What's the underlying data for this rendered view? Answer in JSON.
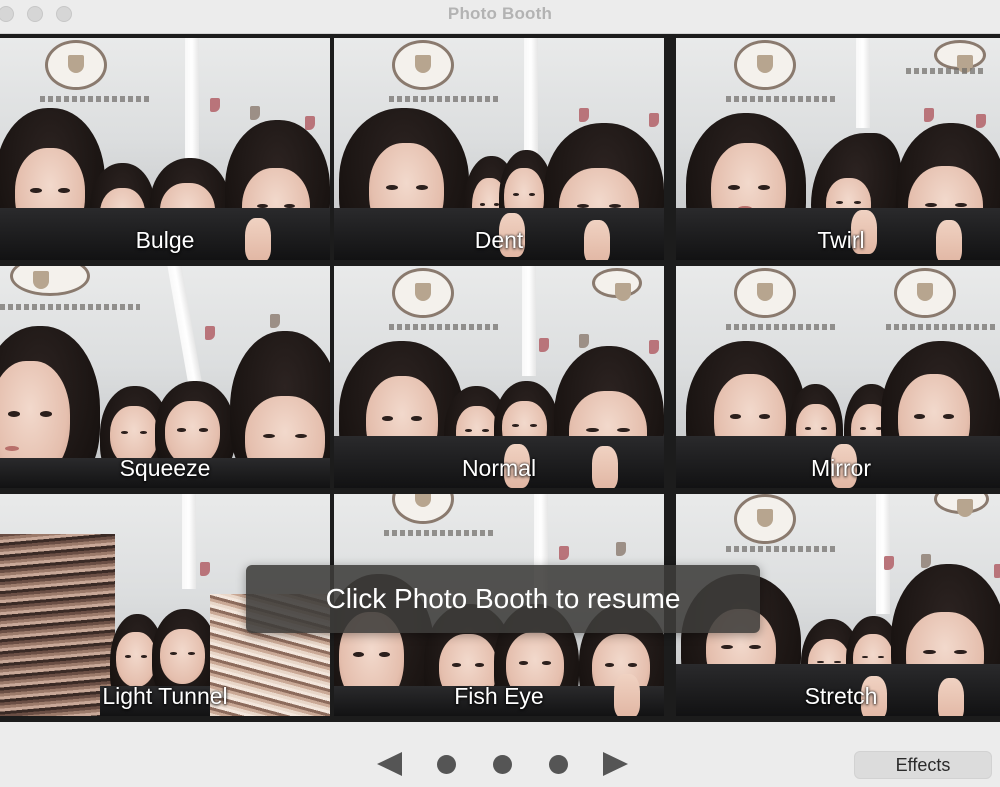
{
  "window": {
    "title": "Photo Booth"
  },
  "effects": [
    {
      "label": "Bulge"
    },
    {
      "label": "Dent"
    },
    {
      "label": "Twirl"
    },
    {
      "label": "Squeeze"
    },
    {
      "label": "Normal"
    },
    {
      "label": "Mirror"
    },
    {
      "label": "Light Tunnel"
    },
    {
      "label": "Fish Eye"
    },
    {
      "label": "Stretch"
    }
  ],
  "overlay": {
    "message": "Click Photo Booth to resume"
  },
  "pager": {
    "page_count": 3
  },
  "toolbar": {
    "effects_label": "Effects"
  },
  "colors": {
    "window_bg": "#ececec",
    "grid_bg": "#1c1c1c",
    "overlay_bg": "#3e3c3a",
    "control_gray": "#555555"
  }
}
